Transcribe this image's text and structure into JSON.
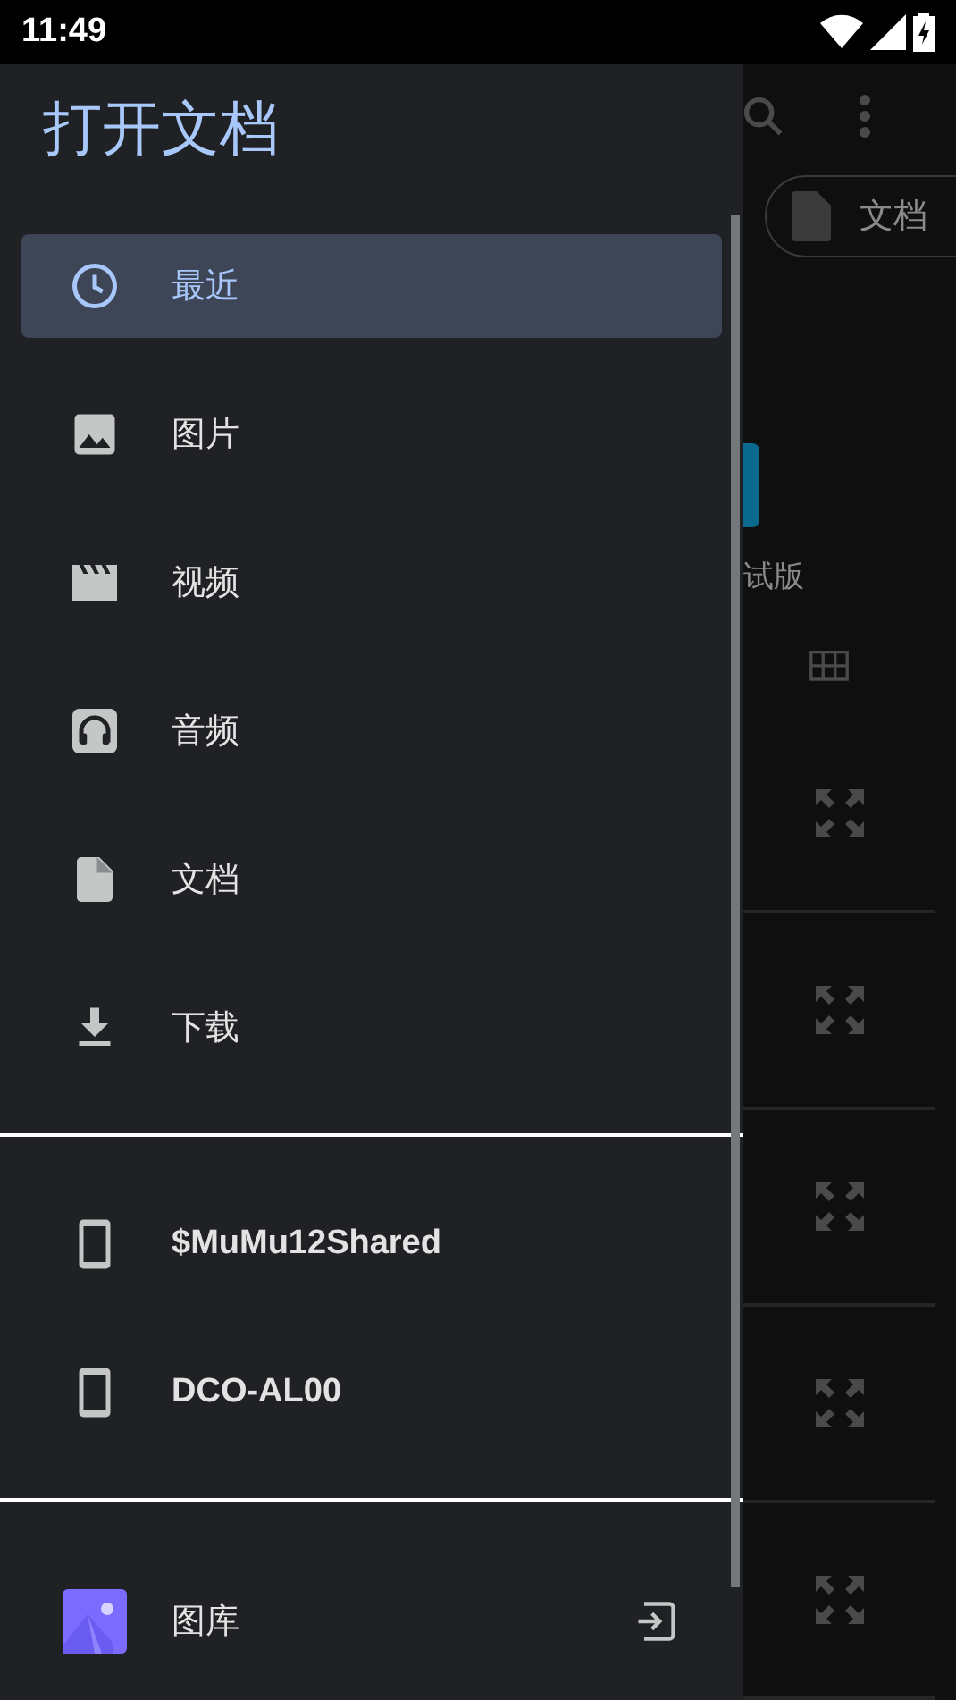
{
  "status_bar": {
    "time": "11:49"
  },
  "drawer": {
    "title": "打开文档",
    "sections": [
      {
        "items": [
          {
            "label": "最近",
            "kind": "clock",
            "selected": true
          },
          {
            "label": "图片",
            "kind": "image",
            "selected": false
          },
          {
            "label": "视频",
            "kind": "video",
            "selected": false
          },
          {
            "label": "音频",
            "kind": "audio",
            "selected": false
          },
          {
            "label": "文档",
            "kind": "document",
            "selected": false
          },
          {
            "label": "下载",
            "kind": "download",
            "selected": false
          }
        ]
      },
      {
        "items": [
          {
            "label": "$MuMu12Shared",
            "kind": "device",
            "selected": false
          },
          {
            "label": "DCO-AL00",
            "kind": "device",
            "selected": false
          }
        ]
      },
      {
        "items": [
          {
            "label": "图库",
            "kind": "gallery",
            "selected": false
          }
        ]
      }
    ]
  },
  "background": {
    "chip": "文档",
    "caption": "试版"
  }
}
